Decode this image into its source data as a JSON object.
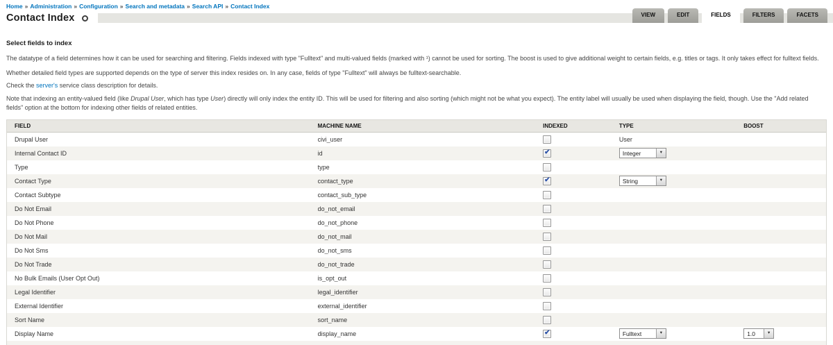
{
  "breadcrumb": {
    "separator": "»",
    "items": [
      "Home",
      "Administration",
      "Configuration",
      "Search and metadata",
      "Search API",
      "Contact Index"
    ]
  },
  "page": {
    "title": "Contact Index"
  },
  "tabs": [
    {
      "label": "VIEW",
      "active": false
    },
    {
      "label": "EDIT",
      "active": false
    },
    {
      "label": "FIELDS",
      "active": true
    },
    {
      "label": "FILTERS",
      "active": false
    },
    {
      "label": "FACETS",
      "active": false
    }
  ],
  "intro": {
    "heading": "Select fields to index",
    "p1": "The datatype of a field determines how it can be used for searching and filtering. Fields indexed with type \"Fulltext\" and multi-valued fields (marked with ¹) cannot be used for sorting. The boost is used to give additional weight to certain fields, e.g. titles or tags. It only takes effect for fulltext fields.",
    "p2": "Whether detailed field types are supported depends on the type of server this index resides on. In any case, fields of type \"Fulltext\" will always be fulltext-searchable.",
    "p3_segments": [
      {
        "text": "Check the ",
        "style": null
      },
      {
        "text": "server's",
        "style": "link"
      },
      {
        "text": " service class description for details.",
        "style": null
      }
    ],
    "p4_segments": [
      {
        "text": "Note that indexing an entity-valued field (like ",
        "style": null
      },
      {
        "text": "Drupal User",
        "style": "em"
      },
      {
        "text": ", which has type ",
        "style": null
      },
      {
        "text": "User",
        "style": "em"
      },
      {
        "text": ") directly will only index the entity ID. This will be used for filtering and also sorting (which might not be what you expect). The entity label will usually be used when displaying the field, though. Use the \"Add related fields\" option at the bottom for indexing other fields of related entities.",
        "style": null
      }
    ]
  },
  "table": {
    "headers": [
      "FIELD",
      "MACHINE NAME",
      "INDEXED",
      "TYPE",
      "BOOST"
    ],
    "rows": [
      {
        "field": "Drupal User",
        "machine": "civi_user",
        "indexed": false,
        "type_text": "User",
        "type_select": null,
        "boost": null
      },
      {
        "field": "Internal Contact ID",
        "machine": "id",
        "indexed": true,
        "type_text": null,
        "type_select": "Integer",
        "boost": null
      },
      {
        "field": "Type",
        "machine": "type",
        "indexed": false,
        "type_text": null,
        "type_select": null,
        "boost": null
      },
      {
        "field": "Contact Type",
        "machine": "contact_type",
        "indexed": true,
        "type_text": null,
        "type_select": "String",
        "boost": null
      },
      {
        "field": "Contact Subtype",
        "machine": "contact_sub_type",
        "indexed": false,
        "type_text": null,
        "type_select": null,
        "boost": null
      },
      {
        "field": "Do Not Email",
        "machine": "do_not_email",
        "indexed": false,
        "type_text": null,
        "type_select": null,
        "boost": null
      },
      {
        "field": "Do Not Phone",
        "machine": "do_not_phone",
        "indexed": false,
        "type_text": null,
        "type_select": null,
        "boost": null
      },
      {
        "field": "Do Not Mail",
        "machine": "do_not_mail",
        "indexed": false,
        "type_text": null,
        "type_select": null,
        "boost": null
      },
      {
        "field": "Do Not Sms",
        "machine": "do_not_sms",
        "indexed": false,
        "type_text": null,
        "type_select": null,
        "boost": null
      },
      {
        "field": "Do Not Trade",
        "machine": "do_not_trade",
        "indexed": false,
        "type_text": null,
        "type_select": null,
        "boost": null
      },
      {
        "field": "No Bulk Emails (User Opt Out)",
        "machine": "is_opt_out",
        "indexed": false,
        "type_text": null,
        "type_select": null,
        "boost": null
      },
      {
        "field": "Legal Identifier",
        "machine": "legal_identifier",
        "indexed": false,
        "type_text": null,
        "type_select": null,
        "boost": null
      },
      {
        "field": "External Identifier",
        "machine": "external_identifier",
        "indexed": false,
        "type_text": null,
        "type_select": null,
        "boost": null
      },
      {
        "field": "Sort Name",
        "machine": "sort_name",
        "indexed": false,
        "type_text": null,
        "type_select": null,
        "boost": null
      },
      {
        "field": "Display Name",
        "machine": "display_name",
        "indexed": true,
        "type_text": null,
        "type_select": "Fulltext",
        "boost": "1.0"
      }
    ]
  },
  "colors": {
    "link_blue": "#0074bd",
    "tab_inactive_gray": "#a8a8a3",
    "row_stripe": "#f4f3ef",
    "header_row_bg": "#e8e7e2",
    "checkbox_check_blue": "#2f54a8"
  }
}
